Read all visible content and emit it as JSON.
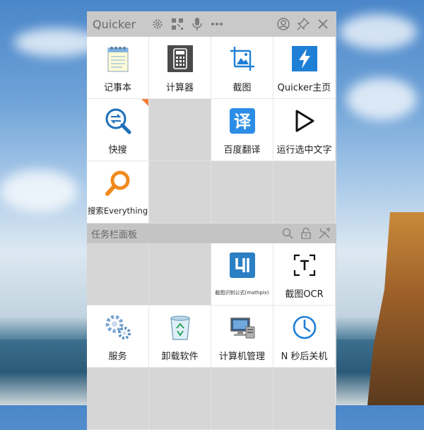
{
  "panel": {
    "title": "Quicker",
    "toolbar_icons": [
      "gear-icon",
      "qr-code-icon",
      "microphone-icon",
      "more-icon"
    ],
    "right_icons": [
      "user-icon",
      "pin-icon",
      "close-icon"
    ]
  },
  "main": {
    "items": [
      {
        "label": "记事本",
        "icon": "notepad-icon"
      },
      {
        "label": "计算器",
        "icon": "calculator-icon"
      },
      {
        "label": "截图",
        "icon": "screenshot-icon"
      },
      {
        "label": "Quicker主页",
        "icon": "lightning-icon"
      },
      {
        "label": "快搜",
        "icon": "quick-search-icon"
      },
      {
        "label": "百度翻译",
        "icon": "translate-icon"
      },
      {
        "label": "运行选中文字",
        "icon": "play-icon"
      },
      {
        "label": "搜索Everything",
        "icon": "everything-search-icon"
      }
    ]
  },
  "section": {
    "title": "任务栏面板",
    "icons": [
      "search-icon",
      "lock-icon",
      "tools-icon"
    ]
  },
  "taskbar": {
    "items": [
      {
        "label": "截图识别公式(mathpix)",
        "icon": "mathpix-icon"
      },
      {
        "label": "截图OCR",
        "icon": "ocr-icon"
      },
      {
        "label": "服务",
        "icon": "services-icon"
      },
      {
        "label": "卸载软件",
        "icon": "recycle-bin-icon"
      },
      {
        "label": "计算机管理",
        "icon": "computer-management-icon"
      },
      {
        "label": "N 秒后关机",
        "icon": "clock-icon"
      }
    ]
  },
  "colors": {
    "corner_badge": "#f07d3a",
    "accent_blue": "#1e7fd6",
    "everything_orange": "#f28a1e"
  }
}
